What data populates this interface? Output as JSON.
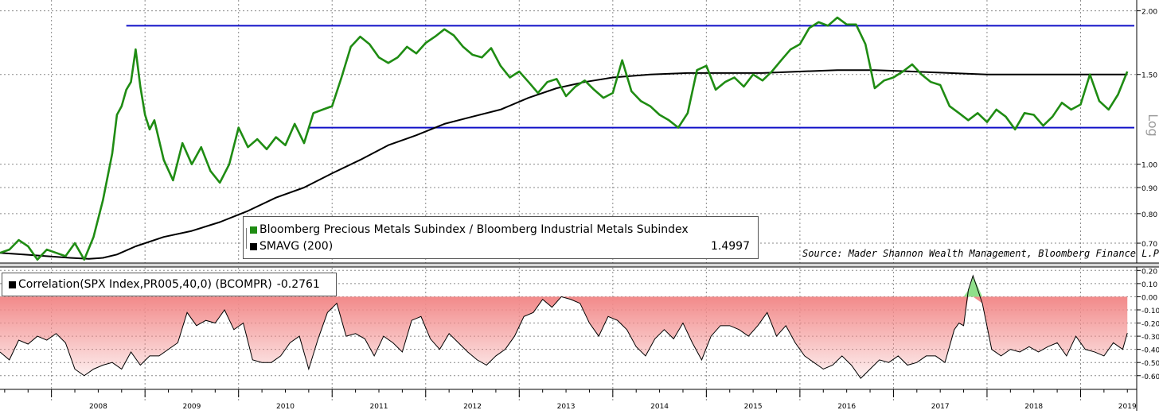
{
  "chart_data": [
    {
      "type": "line",
      "title": "",
      "yscale": "log",
      "ylabel": "Log",
      "ylim": [
        0.64,
        2.1
      ],
      "y_ticks": [
        "2.00",
        "1.50",
        "1.00",
        "0.90",
        "0.80",
        "0.70"
      ],
      "x_ticks": [
        "2008",
        "2009",
        "2010",
        "2011",
        "2012",
        "2013",
        "2014",
        "2015",
        "2016",
        "2017",
        "2018",
        "2019"
      ],
      "xlim": [
        2007.45,
        2019.6
      ],
      "grid": true,
      "series": [
        {
          "name": "Bloomberg Precious Metals Subindex / Bloomberg Industrial Metals Subindex",
          "color": "#1f8c13",
          "x": [
            2007.45,
            2007.55,
            2007.65,
            2007.75,
            2007.85,
            2007.95,
            2008.05,
            2008.15,
            2008.25,
            2008.35,
            2008.45,
            2008.55,
            2008.65,
            2008.7,
            2008.75,
            2008.8,
            2008.85,
            2008.9,
            2008.95,
            2009.0,
            2009.05,
            2009.1,
            2009.2,
            2009.3,
            2009.4,
            2009.5,
            2009.6,
            2009.7,
            2009.8,
            2009.9,
            2010.0,
            2010.1,
            2010.2,
            2010.3,
            2010.4,
            2010.5,
            2010.6,
            2010.7,
            2010.8,
            2010.9,
            2011.0,
            2011.1,
            2011.2,
            2011.3,
            2011.4,
            2011.5,
            2011.6,
            2011.7,
            2011.8,
            2011.9,
            2012.0,
            2012.1,
            2012.2,
            2012.3,
            2012.4,
            2012.5,
            2012.6,
            2012.7,
            2012.8,
            2012.9,
            2013.0,
            2013.1,
            2013.2,
            2013.3,
            2013.4,
            2013.5,
            2013.6,
            2013.7,
            2013.8,
            2013.9,
            2014.0,
            2014.1,
            2014.2,
            2014.3,
            2014.4,
            2014.5,
            2014.6,
            2014.7,
            2014.8,
            2014.9,
            2015.0,
            2015.1,
            2015.2,
            2015.3,
            2015.4,
            2015.5,
            2015.6,
            2015.7,
            2015.8,
            2015.9,
            2016.0,
            2016.1,
            2016.2,
            2016.3,
            2016.4,
            2016.5,
            2016.6,
            2016.7,
            2016.8,
            2016.9,
            2017.0,
            2017.1,
            2017.2,
            2017.3,
            2017.4,
            2017.5,
            2017.6,
            2017.7,
            2017.8,
            2017.9,
            2018.0,
            2018.1,
            2018.2,
            2018.3,
            2018.4,
            2018.5,
            2018.6,
            2018.7,
            2018.8,
            2018.9,
            2019.0,
            2019.1,
            2019.2,
            2019.3,
            2019.4,
            2019.5
          ],
          "values": [
            0.67,
            0.68,
            0.71,
            0.69,
            0.65,
            0.68,
            0.67,
            0.66,
            0.7,
            0.65,
            0.72,
            0.85,
            1.05,
            1.25,
            1.3,
            1.4,
            1.45,
            1.68,
            1.42,
            1.25,
            1.17,
            1.22,
            1.02,
            0.93,
            1.1,
            1.0,
            1.08,
            0.97,
            0.92,
            1.0,
            1.18,
            1.08,
            1.12,
            1.07,
            1.13,
            1.09,
            1.2,
            1.1,
            1.26,
            1.28,
            1.3,
            1.48,
            1.7,
            1.78,
            1.72,
            1.62,
            1.58,
            1.62,
            1.7,
            1.65,
            1.73,
            1.78,
            1.84,
            1.79,
            1.7,
            1.64,
            1.62,
            1.69,
            1.56,
            1.48,
            1.52,
            1.45,
            1.38,
            1.45,
            1.47,
            1.36,
            1.42,
            1.46,
            1.4,
            1.35,
            1.38,
            1.6,
            1.39,
            1.33,
            1.3,
            1.25,
            1.22,
            1.18,
            1.26,
            1.53,
            1.56,
            1.4,
            1.45,
            1.48,
            1.42,
            1.5,
            1.46,
            1.52,
            1.6,
            1.68,
            1.72,
            1.85,
            1.9,
            1.87,
            1.94,
            1.88,
            1.88,
            1.72,
            1.41,
            1.46,
            1.48,
            1.52,
            1.57,
            1.5,
            1.45,
            1.43,
            1.3,
            1.26,
            1.22,
            1.26,
            1.21,
            1.28,
            1.24,
            1.17,
            1.26,
            1.25,
            1.19,
            1.24,
            1.32,
            1.28,
            1.31,
            1.5,
            1.33,
            1.28,
            1.37,
            1.52
          ]
        },
        {
          "name": "SMAVG (200)",
          "color": "#000000",
          "x": [
            2007.45,
            2007.7,
            2007.95,
            2008.2,
            2008.4,
            2008.55,
            2008.7,
            2008.9,
            2009.2,
            2009.5,
            2009.8,
            2010.1,
            2010.4,
            2010.7,
            2011.0,
            2011.3,
            2011.6,
            2011.9,
            2012.2,
            2012.5,
            2012.8,
            2013.1,
            2013.4,
            2013.7,
            2014.0,
            2014.4,
            2014.8,
            2015.2,
            2015.6,
            2016.0,
            2016.4,
            2016.8,
            2017.2,
            2017.6,
            2018.0,
            2018.4,
            2018.8,
            2019.2,
            2019.5
          ],
          "values": [
            0.67,
            0.665,
            0.66,
            0.655,
            0.652,
            0.655,
            0.665,
            0.69,
            0.72,
            0.74,
            0.77,
            0.81,
            0.86,
            0.9,
            0.96,
            1.02,
            1.09,
            1.14,
            1.2,
            1.24,
            1.28,
            1.35,
            1.41,
            1.45,
            1.48,
            1.5,
            1.51,
            1.51,
            1.51,
            1.52,
            1.53,
            1.53,
            1.52,
            1.51,
            1.5,
            1.5,
            1.5,
            1.5,
            1.4997
          ]
        }
      ],
      "reference_lines": [
        {
          "y": 1.87,
          "x_from": 2008.8,
          "x_to": 2019.6,
          "color": "#1010c8"
        },
        {
          "y": 1.18,
          "x_from": 2010.75,
          "x_to": 2019.6,
          "color": "#1010c8"
        }
      ],
      "legend": [
        {
          "label": "Bloomberg Precious Metals Subindex / Bloomberg Industrial Metals Subindex",
          "color": "#1f8c13"
        },
        {
          "label": "SMAVG (200)",
          "color": "#000000",
          "value": "1.4997"
        }
      ],
      "annotation": "Source: Mader Shannon Wealth Management, Bloomberg Finance L.P."
    },
    {
      "type": "area",
      "title": "",
      "ylim": [
        -0.68,
        0.22
      ],
      "y_ticks": [
        "0.20",
        "0.10",
        "0.00",
        "-0.10",
        "-0.20",
        "-0.30",
        "-0.40",
        "-0.50",
        "-0.60"
      ],
      "grid": true,
      "series": [
        {
          "name": "Correlation(SPX Index,PR005,40,0) (BCOMPR)",
          "last_value": "-0.2761",
          "positive_color": "#8fe08a",
          "negative_color": "#f28a8a",
          "x": [
            2007.45,
            2007.55,
            2007.65,
            2007.75,
            2007.85,
            2007.95,
            2008.05,
            2008.15,
            2008.25,
            2008.35,
            2008.45,
            2008.55,
            2008.65,
            2008.75,
            2008.85,
            2008.95,
            2009.05,
            2009.15,
            2009.25,
            2009.35,
            2009.45,
            2009.55,
            2009.65,
            2009.75,
            2009.85,
            2009.95,
            2010.05,
            2010.15,
            2010.25,
            2010.35,
            2010.45,
            2010.55,
            2010.65,
            2010.75,
            2010.85,
            2010.95,
            2011.05,
            2011.15,
            2011.25,
            2011.35,
            2011.45,
            2011.55,
            2011.65,
            2011.75,
            2011.85,
            2011.95,
            2012.05,
            2012.15,
            2012.25,
            2012.35,
            2012.45,
            2012.55,
            2012.65,
            2012.75,
            2012.85,
            2012.95,
            2013.05,
            2013.15,
            2013.25,
            2013.35,
            2013.45,
            2013.55,
            2013.65,
            2013.75,
            2013.85,
            2013.95,
            2014.05,
            2014.15,
            2014.25,
            2014.35,
            2014.45,
            2014.55,
            2014.65,
            2014.75,
            2014.85,
            2014.95,
            2015.05,
            2015.15,
            2015.25,
            2015.35,
            2015.45,
            2015.55,
            2015.65,
            2015.75,
            2015.85,
            2015.95,
            2016.05,
            2016.15,
            2016.25,
            2016.35,
            2016.45,
            2016.55,
            2016.65,
            2016.75,
            2016.85,
            2016.95,
            2017.05,
            2017.15,
            2017.25,
            2017.35,
            2017.45,
            2017.55,
            2017.65,
            2017.7,
            2017.75,
            2017.8,
            2017.85,
            2017.95,
            2018.05,
            2018.15,
            2018.25,
            2018.35,
            2018.45,
            2018.55,
            2018.65,
            2018.75,
            2018.85,
            2018.95,
            2019.05,
            2019.15,
            2019.25,
            2019.35,
            2019.45,
            2019.5
          ],
          "values": [
            -0.42,
            -0.48,
            -0.33,
            -0.36,
            -0.3,
            -0.33,
            -0.28,
            -0.35,
            -0.55,
            -0.6,
            -0.55,
            -0.52,
            -0.5,
            -0.55,
            -0.42,
            -0.52,
            -0.45,
            -0.45,
            -0.4,
            -0.35,
            -0.12,
            -0.22,
            -0.18,
            -0.2,
            -0.1,
            -0.25,
            -0.2,
            -0.48,
            -0.5,
            -0.5,
            -0.45,
            -0.35,
            -0.3,
            -0.55,
            -0.32,
            -0.12,
            -0.05,
            -0.3,
            -0.28,
            -0.32,
            -0.45,
            -0.3,
            -0.35,
            -0.42,
            -0.18,
            -0.15,
            -0.32,
            -0.4,
            -0.28,
            -0.35,
            -0.42,
            -0.48,
            -0.52,
            -0.45,
            -0.4,
            -0.3,
            -0.15,
            -0.12,
            -0.02,
            -0.08,
            0.0,
            -0.02,
            -0.05,
            -0.2,
            -0.3,
            -0.15,
            -0.18,
            -0.25,
            -0.38,
            -0.45,
            -0.32,
            -0.25,
            -0.32,
            -0.2,
            -0.35,
            -0.48,
            -0.3,
            -0.22,
            -0.22,
            -0.25,
            -0.3,
            -0.22,
            -0.12,
            -0.3,
            -0.22,
            -0.35,
            -0.45,
            -0.5,
            -0.55,
            -0.52,
            -0.45,
            -0.52,
            -0.62,
            -0.55,
            -0.48,
            -0.5,
            -0.45,
            -0.52,
            -0.5,
            -0.45,
            -0.45,
            -0.5,
            -0.25,
            -0.2,
            -0.22,
            0.05,
            0.16,
            -0.05,
            -0.4,
            -0.45,
            -0.4,
            -0.42,
            -0.38,
            -0.42,
            -0.38,
            -0.35,
            -0.45,
            -0.3,
            -0.4,
            -0.42,
            -0.45,
            -0.35,
            -0.4,
            -0.2761
          ]
        }
      ],
      "x_ticks": [
        "2008",
        "2009",
        "2010",
        "2011",
        "2012",
        "2013",
        "2014",
        "2015",
        "2016",
        "2017",
        "2018",
        "2019"
      ]
    }
  ]
}
